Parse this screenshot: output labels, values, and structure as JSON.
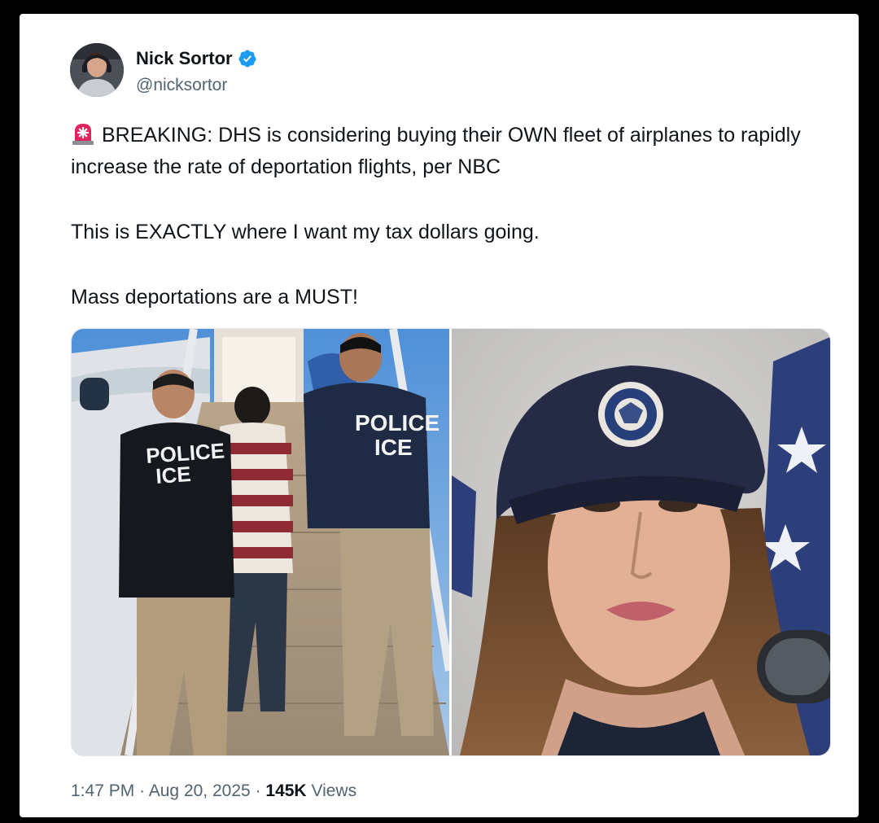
{
  "tweet": {
    "author_name": "Nick Sortor",
    "author_handle": "@nicksortor",
    "verified": true,
    "paragraphs": [
      "BREAKING: DHS is considering buying their OWN fleet of airplanes to rapidly increase the rate of deportation flights, per NBC",
      "This is EXACTLY where I want my tax dollars going.",
      "Mass deportations are a MUST!"
    ],
    "leading_emoji": "siren-emoji",
    "media": {
      "left_jacket_text_1": "POLICE",
      "left_jacket_text_2": "ICE",
      "right_jacket_text_1": "POLICE",
      "right_jacket_text_2": "ICE"
    },
    "time": "1:47 PM",
    "date": "Aug 20, 2025",
    "separator": "·",
    "views_count": "145K",
    "views_label": "Views"
  },
  "colors": {
    "accent_blue": "#1d9bf0",
    "text_primary": "#0f1419",
    "text_secondary": "#536471"
  }
}
